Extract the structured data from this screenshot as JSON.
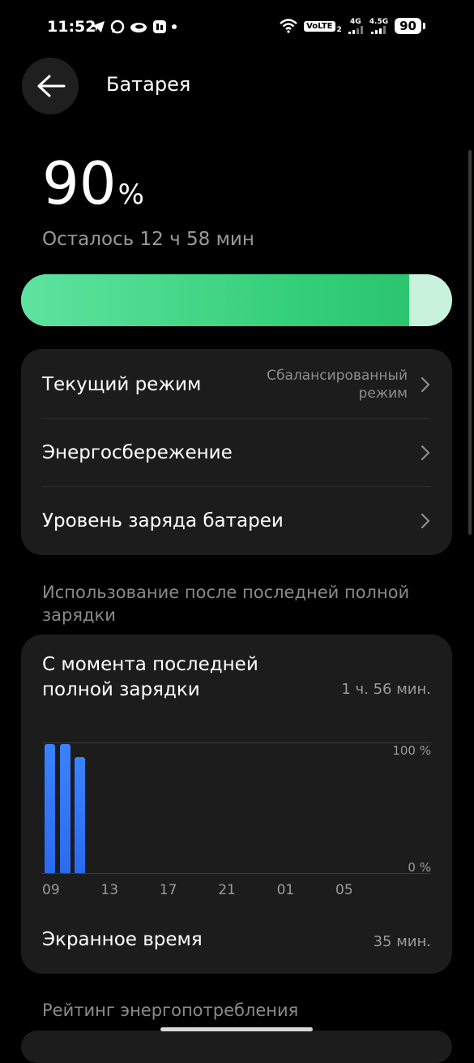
{
  "status_bar": {
    "time": "11:52",
    "volte": "VoLTE",
    "sim_index": "2",
    "net1": "4G",
    "net2": "4.5G",
    "battery": "90"
  },
  "header": {
    "title": "Батарея"
  },
  "battery": {
    "percent": "90",
    "percent_sign": "%",
    "level": 0.9,
    "remaining": "Осталось 12 ч 58 мин"
  },
  "menu": [
    {
      "label": "Текущий режим",
      "value_line1": "Сбалансированный",
      "value_line2": "режим"
    },
    {
      "label": "Энергосбережение"
    },
    {
      "label": "Уровень заряда батареи"
    }
  ],
  "usage": {
    "section_title": "Использование после последней полной зарядки",
    "since_label": "С момента последней полной зарядки",
    "since_value": "1 ч. 56 мин.",
    "screen_label": "Экранное время",
    "screen_value": "35 мин."
  },
  "chart_data": {
    "type": "bar",
    "y_labels": [
      "100 %",
      "0 %"
    ],
    "x_ticks": [
      "09",
      "13",
      "17",
      "21",
      "01",
      "05"
    ],
    "values": [
      99,
      99,
      89
    ],
    "ylim": [
      0,
      100
    ],
    "color": "#2f74f7"
  },
  "rating": {
    "section_title": "Рейтинг энергопотребления"
  },
  "colors": {
    "accent_green": "#35cf7a",
    "bar_blue": "#2f74f7",
    "card_bg": "#1c1c1c"
  }
}
